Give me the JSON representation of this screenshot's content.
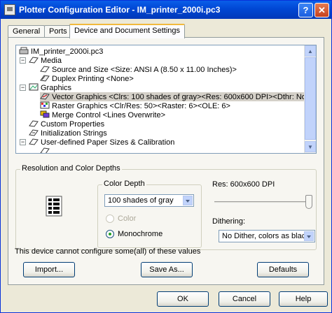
{
  "window": {
    "title": "Plotter Configuration Editor - IM_printer_2000i.pc3"
  },
  "tabs": [
    {
      "label": "General"
    },
    {
      "label": "Ports"
    },
    {
      "label": "Device and Document Settings"
    }
  ],
  "tree": {
    "items": [
      {
        "label": "IM_printer_2000i.pc3",
        "icon": "printer-icon"
      },
      {
        "label": "Media",
        "icon": "media-icon"
      },
      {
        "label": "Source and Size <Size: ANSI A (8.50 x 11.00 Inches)>",
        "icon": "paper-icon"
      },
      {
        "label": "Duplex Printing <None>",
        "icon": "duplex-icon"
      },
      {
        "label": "Graphics",
        "icon": "graphics-icon"
      },
      {
        "label": "Vector Graphics <Clrs: 100 shades of gray><Res: 600x600 DPI><Dthr: No Dither, colors as black",
        "icon": "vector-graphics-icon"
      },
      {
        "label": "Raster Graphics <Clr/Res: 50><Raster: 6><OLE: 6>",
        "icon": "raster-graphics-icon"
      },
      {
        "label": "Merge Control <Lines Overwrite>",
        "icon": "merge-control-icon"
      },
      {
        "label": "Custom Properties",
        "icon": "custom-properties-icon"
      },
      {
        "label": "Initialization Strings",
        "icon": "init-strings-icon"
      },
      {
        "label": "User-defined Paper Sizes & Calibration",
        "icon": "paper-sizes-icon"
      }
    ]
  },
  "resolution_group": {
    "title": "Resolution and Color Depths",
    "color_depth": {
      "title": "Color Depth",
      "selected": "100 shades of gray",
      "color_label": "Color",
      "monochrome_label": "Monochrome",
      "selected_mode": "Monochrome"
    },
    "resolution_label": "Res: 600x600 DPI",
    "slider_level": 1.0,
    "dithering_label": "Dithering:",
    "dithering_selected": "No Dither, colors as black"
  },
  "note": "This device cannot configure some(all) of these values",
  "buttons": {
    "import": "Import...",
    "save_as": "Save As...",
    "defaults": "Defaults",
    "ok": "OK",
    "cancel": "Cancel",
    "help": "Help"
  }
}
